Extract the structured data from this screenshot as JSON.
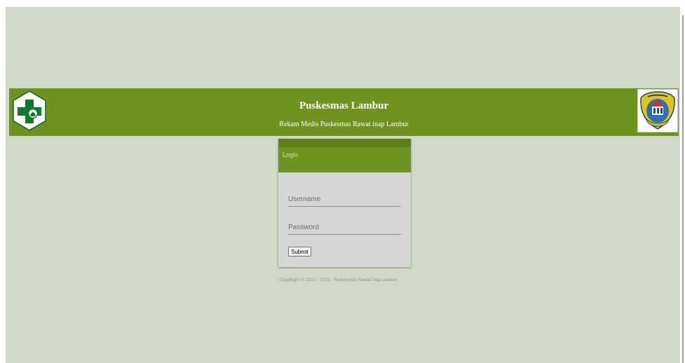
{
  "header": {
    "title": "Puskesmas Lambur",
    "subtitle": "Rekam Medis Puskesmas Rawat inap Lambur",
    "left_logo": "puskesmas-logo-icon",
    "right_logo": "regency-emblem-icon"
  },
  "login": {
    "title": "Login",
    "username_placeholder": "Username",
    "password_placeholder": "Password",
    "submit_label": "Submit"
  },
  "footer": {
    "copyright": "CopyRight © 2021 - 2022 - Puskesmas Rawat inap Lambur"
  },
  "colors": {
    "page_background": "#d1dac8",
    "header_green": "#6e931f",
    "card_background": "#d6d6d6",
    "logo_green": "#0e7a2c"
  }
}
